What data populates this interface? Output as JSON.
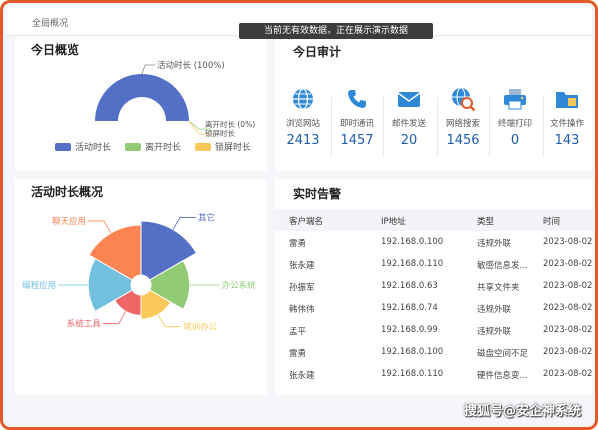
{
  "window": {
    "title": "全局概况"
  },
  "toast": {
    "message": "当前无有效数据，正在展示演示数据"
  },
  "today_overview": {
    "title": "今日概览",
    "chart_data": {
      "type": "pie",
      "style": "half-donut",
      "slices": [
        {
          "name": "活动时长",
          "value": 100,
          "color": "#5470c6",
          "label": "活动时长 (100%)"
        },
        {
          "name": "离开时长",
          "value": 0,
          "color": "#91cc75",
          "label": "离开时长 (0%)"
        },
        {
          "name": "锁屏时长",
          "value": 0,
          "color": "#fac858",
          "label": "锁屏时长"
        }
      ],
      "legend": [
        "活动时长",
        "离开时长",
        "锁屏时长"
      ],
      "legend_position": "bottom"
    }
  },
  "today_audit": {
    "title": "今日审计",
    "items": [
      {
        "icon": "globe-icon",
        "label": "浏览网站",
        "value": "2413"
      },
      {
        "icon": "phone-icon",
        "label": "即时通讯",
        "value": "1457"
      },
      {
        "icon": "mail-icon",
        "label": "邮件发送",
        "value": "20"
      },
      {
        "icon": "web-search-icon",
        "label": "网络搜索",
        "value": "1456"
      },
      {
        "icon": "printer-icon",
        "label": "终端打印",
        "value": "0"
      },
      {
        "icon": "folder-icon",
        "label": "文件操作",
        "value": "143"
      }
    ]
  },
  "active_duration": {
    "title": "活动时长概况",
    "chart_data": {
      "type": "pie",
      "style": "rose",
      "slices": [
        {
          "name": "其它",
          "value": 35,
          "color": "#5470c6"
        },
        {
          "name": "办公系统",
          "value": 18,
          "color": "#91cc75"
        },
        {
          "name": "培训办公",
          "value": 7,
          "color": "#fac858"
        },
        {
          "name": "系统工具",
          "value": 5,
          "color": "#ee6666"
        },
        {
          "name": "编程应用",
          "value": 22,
          "color": "#73c0de"
        },
        {
          "name": "聊天应用",
          "value": 30,
          "color": "#fc8452"
        }
      ]
    }
  },
  "realtime_alerts": {
    "title": "实时告警",
    "columns": [
      "客户端名",
      "IP地址",
      "类型",
      "时间"
    ],
    "rows": [
      [
        "雷勇",
        "192.168.0.100",
        "违规外联",
        "2023-08-02"
      ],
      [
        "张永建",
        "192.168.0.110",
        "敏感信息发...",
        "2023-08-02"
      ],
      [
        "孙振军",
        "192.168.0.63",
        "共享文件夹",
        "2023-08-02"
      ],
      [
        "韩伟伟",
        "192.168.0.74",
        "违规外联",
        "2023-08-02"
      ],
      [
        "孟平",
        "192.168.0.99",
        "违规外联",
        "2023-08-02"
      ],
      [
        "雷勇",
        "192.168.0.100",
        "磁盘空间不足",
        "2023-08-02"
      ],
      [
        "张永建",
        "192.168.0.110",
        "硬件信息变...",
        "2023-08-02"
      ]
    ]
  },
  "watermark": {
    "text": "搜狐号@安企神系统"
  }
}
